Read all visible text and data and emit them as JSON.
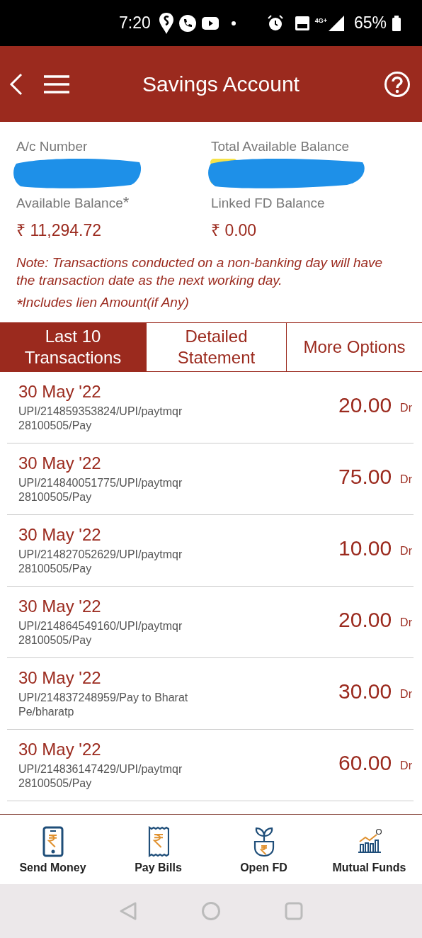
{
  "status_bar": {
    "time": "7:20",
    "network": "4G+",
    "battery": "65%"
  },
  "header": {
    "title": "Savings Account"
  },
  "account": {
    "fields": [
      {
        "label": "A/c Number",
        "redacted": true
      },
      {
        "label": "Total Available Balance",
        "redacted": true
      },
      {
        "label": "Available Balance",
        "mark": "*",
        "value": "₹ 11,294.72"
      },
      {
        "label": "Linked FD Balance",
        "value": "₹ 0.00"
      }
    ],
    "note": "Note: Transactions conducted on a non-banking day will have the transaction date as the next working day.",
    "footnote": "$^{*}$Includes lien Amount(if Any)"
  },
  "tabs": [
    {
      "label": "Last 10\nTransactions",
      "selected": true
    },
    {
      "label": "Detailed\nStatement",
      "selected": false
    },
    {
      "label": "More Options",
      "selected": false
    }
  ],
  "transactions": [
    {
      "date": "30 May '22",
      "description": "UPI/214859353824/UPI/paytmqr\n28100505/Pay",
      "amount": "20.00",
      "type": "Dr"
    },
    {
      "date": "30 May '22",
      "description": "UPI/214840051775/UPI/paytmqr\n28100505/Pay",
      "amount": "75.00",
      "type": "Dr"
    },
    {
      "date": "30 May '22",
      "description": "UPI/214827052629/UPI/paytmqr\n28100505/Pay",
      "amount": "10.00",
      "type": "Dr"
    },
    {
      "date": "30 May '22",
      "description": "UPI/214864549160/UPI/paytmqr\n28100505/Pay",
      "amount": "20.00",
      "type": "Dr"
    },
    {
      "date": "30 May '22",
      "description": "UPI/214837248959/Pay to Bharat\nPe/bharatp",
      "amount": "30.00",
      "type": "Dr"
    },
    {
      "date": "30 May '22",
      "description": "UPI/214836147429/UPI/paytmqr\n28100505/Pay",
      "amount": "60.00",
      "type": "Dr"
    }
  ],
  "bottom_nav": [
    {
      "label": "Send Money",
      "kind": "phone"
    },
    {
      "label": "Pay Bills",
      "kind": "bill"
    },
    {
      "label": "Open FD",
      "kind": "plant"
    },
    {
      "label": "Mutual Funds",
      "kind": "chart"
    }
  ]
}
